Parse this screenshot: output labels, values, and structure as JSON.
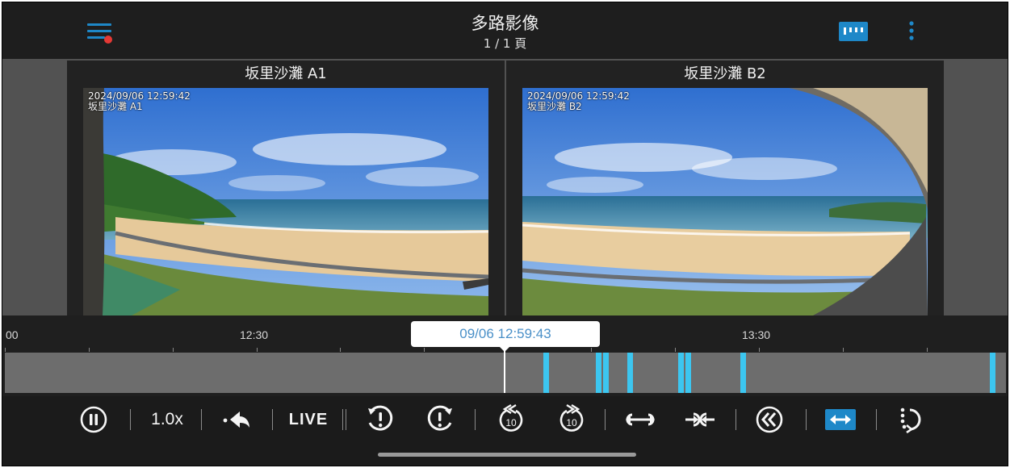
{
  "header": {
    "title": "多路影像",
    "page_indicator": "1 / 1 頁",
    "icons": {
      "menu": "menu-icon",
      "layout": "layout-icon",
      "more": "more-vertical-icon"
    },
    "notification_dot_color": "#e53935",
    "accent_color": "#1e88c8"
  },
  "cameras": [
    {
      "title": "坂里沙灘 A1",
      "osd_time": "2024/09/06 12:59:42",
      "osd_name": "坂里沙灘 A1"
    },
    {
      "title": "坂里沙灘 B2",
      "osd_time": "2024/09/06 12:59:42",
      "osd_name": "坂里沙灘 B2"
    }
  ],
  "timeline": {
    "tick_labels": [
      "00",
      "12:30",
      "13:30"
    ],
    "current_time": "09/06 12:59:43",
    "event_color": "#3cc6f0"
  },
  "controls": {
    "pause": "pause-icon",
    "speed_label": "1.0x",
    "back_to_start": "return-icon",
    "live_label": "LIVE",
    "prev_event": "previous-event-icon",
    "next_event": "next-event-icon",
    "rewind_label": "10",
    "forward_label": "10",
    "expand_timeline": "expand-timeline-icon",
    "shrink_timeline": "shrink-timeline-icon",
    "rewind_all": "rewind-icon",
    "sync_toggle": "sync-icon",
    "rotate": "rotate-icon"
  }
}
